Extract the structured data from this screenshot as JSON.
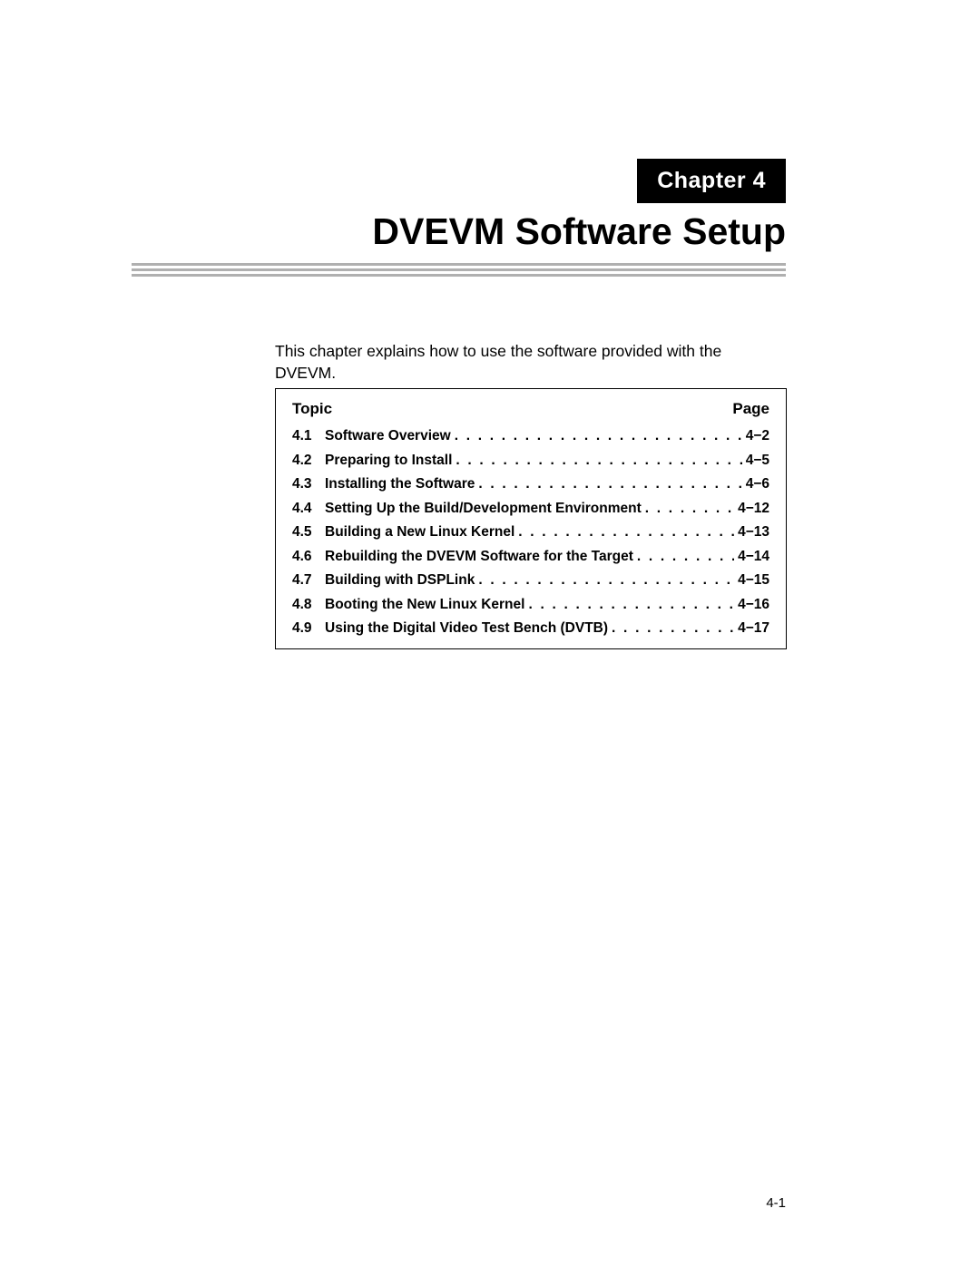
{
  "chapter": {
    "label": "Chapter 4",
    "title": "DVEVM Software Setup"
  },
  "intro": "This chapter explains how to use the software provided with the DVEVM.",
  "toc": {
    "header_topic": "Topic",
    "header_page": "Page",
    "items": [
      {
        "num": "4.1",
        "title": "Software Overview",
        "page": "4−2"
      },
      {
        "num": "4.2",
        "title": "Preparing to Install",
        "page": "4−5"
      },
      {
        "num": "4.3",
        "title": "Installing the Software",
        "page": "4−6"
      },
      {
        "num": "4.4",
        "title": "Setting Up the Build/Development Environment",
        "page": "4−12"
      },
      {
        "num": "4.5",
        "title": "Building a New Linux Kernel",
        "page": "4−13"
      },
      {
        "num": "4.6",
        "title": "Rebuilding the DVEVM Software for the Target",
        "page": "4−14"
      },
      {
        "num": "4.7",
        "title": "Building with DSPLink",
        "page": "4−15"
      },
      {
        "num": "4.8",
        "title": "Booting the New Linux Kernel",
        "page": "4−16"
      },
      {
        "num": "4.9",
        "title": "Using the Digital Video Test Bench (DVTB)",
        "page": "4−17"
      }
    ]
  },
  "footer": {
    "page_num": "4-1"
  }
}
